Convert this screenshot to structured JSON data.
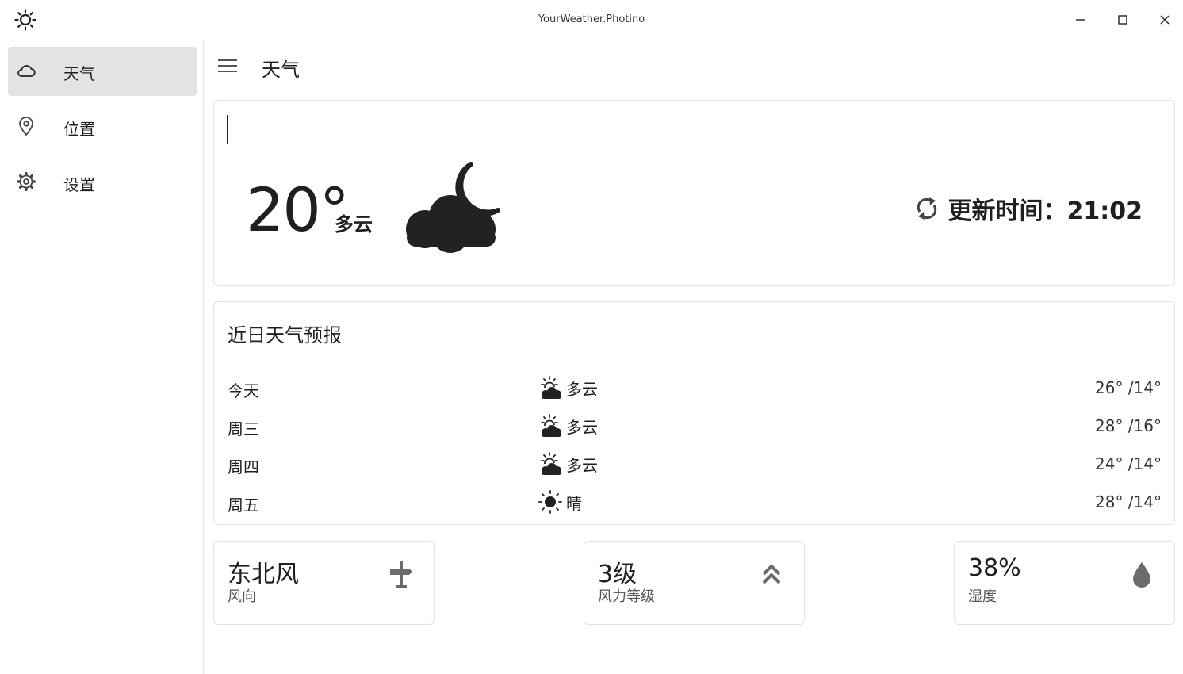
{
  "window": {
    "title": "YourWeather.Photino"
  },
  "sidebar": {
    "items": [
      {
        "label": "天气",
        "icon": "cloud-icon",
        "active": true
      },
      {
        "label": "位置",
        "icon": "location-pin-icon",
        "active": false
      },
      {
        "label": "设置",
        "icon": "gear-icon",
        "active": false
      }
    ]
  },
  "header": {
    "title": "天气"
  },
  "current": {
    "temperature": "20°",
    "condition": "多云",
    "icon": "cloudy-night-icon",
    "update": "更新时间：21:02"
  },
  "forecast": {
    "title": "近日天气预报",
    "rows": [
      {
        "day": "今天",
        "icon": "partly-cloudy-icon",
        "condition": "多云",
        "temps": "26° /14°"
      },
      {
        "day": "周三",
        "icon": "partly-cloudy-icon",
        "condition": "多云",
        "temps": "28° /16°"
      },
      {
        "day": "周四",
        "icon": "partly-cloudy-icon",
        "condition": "多云",
        "temps": "24° /14°"
      },
      {
        "day": "周五",
        "icon": "sun-icon",
        "condition": "晴",
        "temps": "28° /14°"
      }
    ]
  },
  "details": [
    {
      "value": "东北风",
      "label": "风向",
      "icon": "signpost-icon"
    },
    {
      "value": "3级",
      "label": "风力等级",
      "icon": "double-chevron-up-icon"
    },
    {
      "value": "38%",
      "label": "湿度",
      "icon": "water-drop-icon"
    }
  ],
  "colors": {
    "text": "#1f1f1f",
    "nav_active": "#e3e3e3",
    "icon": "#6b6b6b"
  }
}
